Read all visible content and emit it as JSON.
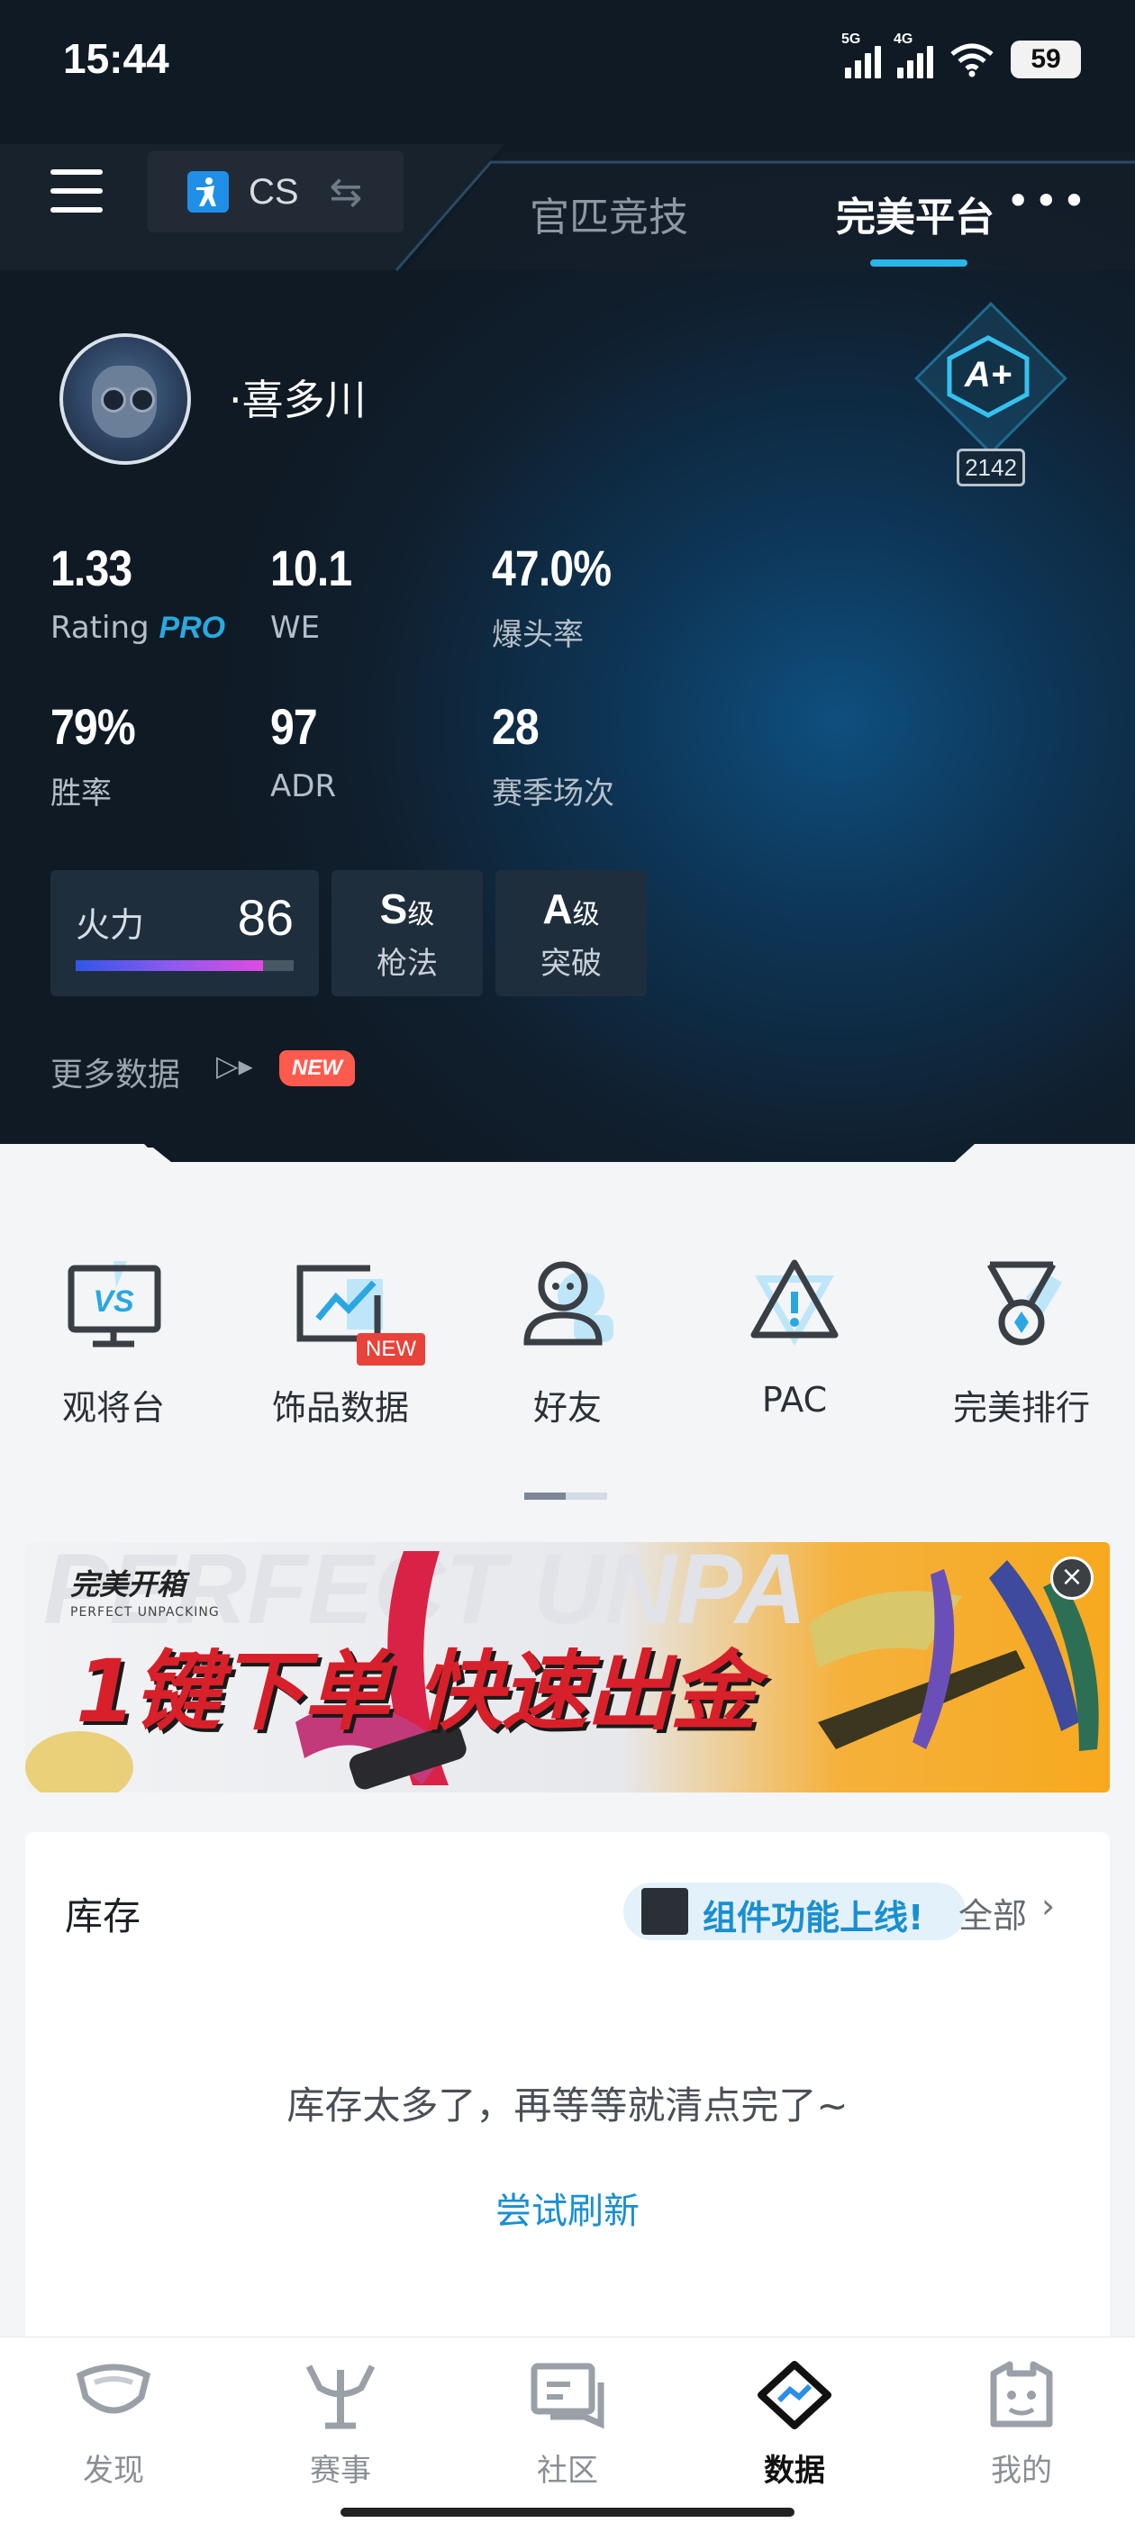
{
  "status_bar": {
    "time": "15:44",
    "sim1_label": "5G",
    "sim2_label": "4G",
    "battery": "59"
  },
  "top_bar": {
    "game_name": "CS",
    "tabs": [
      {
        "label": "官匹竞技",
        "active": false
      },
      {
        "label": "完美平台",
        "active": true
      }
    ]
  },
  "profile": {
    "username": "·喜多川",
    "rank_badge": "A+",
    "rank_score": "2142"
  },
  "stats": [
    {
      "value": "1.33",
      "label": "Rating",
      "label_suffix": "PRO"
    },
    {
      "value": "10.1",
      "label": "WE"
    },
    {
      "value": "47.0%",
      "label": "爆头率"
    },
    {
      "value": "79%",
      "label": "胜率"
    },
    {
      "value": "97",
      "label": "ADR"
    },
    {
      "value": "28",
      "label": "赛季场次"
    }
  ],
  "abilities": {
    "firepower_label": "火力",
    "firepower_value": "86",
    "firepower_fraction": 0.86,
    "grades": [
      {
        "grade": "S",
        "suffix": "级",
        "label": "枪法"
      },
      {
        "grade": "A",
        "suffix": "级",
        "label": "突破"
      }
    ]
  },
  "more_data": {
    "label": "更多数据",
    "badge": "NEW"
  },
  "quick_actions": [
    {
      "label": "观将台",
      "icon": "vs-monitor-icon"
    },
    {
      "label": "饰品数据",
      "icon": "chart-board-icon",
      "badge": "NEW"
    },
    {
      "label": "好友",
      "icon": "friend-icon"
    },
    {
      "label": "PAC",
      "icon": "warning-triangle-icon"
    },
    {
      "label": "完美排行",
      "icon": "medal-icon"
    }
  ],
  "banner": {
    "logo_text": "完美开箱",
    "logo_sub": "PERFECT UNPACKING",
    "headline": "1键下单 快速出金"
  },
  "inventory": {
    "title": "库存",
    "feature_text": "组件功能上线!",
    "all_label": "全部",
    "message": "库存太多了，再等等就清点完了~",
    "refresh_label": "尝试刷新"
  },
  "bottom_nav": [
    {
      "label": "发现",
      "icon": "discover-icon",
      "active": false
    },
    {
      "label": "赛事",
      "icon": "trophy-icon",
      "active": false
    },
    {
      "label": "社区",
      "icon": "community-icon",
      "active": false
    },
    {
      "label": "数据",
      "icon": "data-icon",
      "active": true
    },
    {
      "label": "我的",
      "icon": "profile-icon",
      "active": false
    }
  ],
  "colors": {
    "accent": "#29b5e8",
    "link": "#1a8fd0",
    "new_badge": "#e8433b"
  }
}
